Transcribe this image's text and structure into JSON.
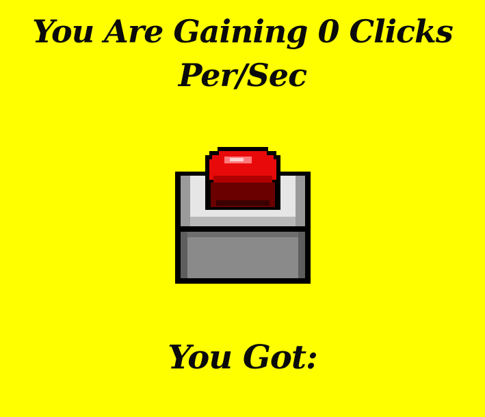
{
  "header": {
    "rate_line_1": "You Are Gaining 0 Clicks",
    "rate_line_2": "Per/Sec"
  },
  "button": {
    "icon": "red-push-button-icon",
    "colors": {
      "cap": "#e80a0a",
      "cap_shadow": "#7a0000",
      "housing_top": "#cfcfcf",
      "housing_front": "#8a8a8a",
      "outline": "#000000"
    }
  },
  "score": {
    "label": "You Got:"
  },
  "colors": {
    "background": "#ffff00",
    "text": "#0a0a0a"
  }
}
